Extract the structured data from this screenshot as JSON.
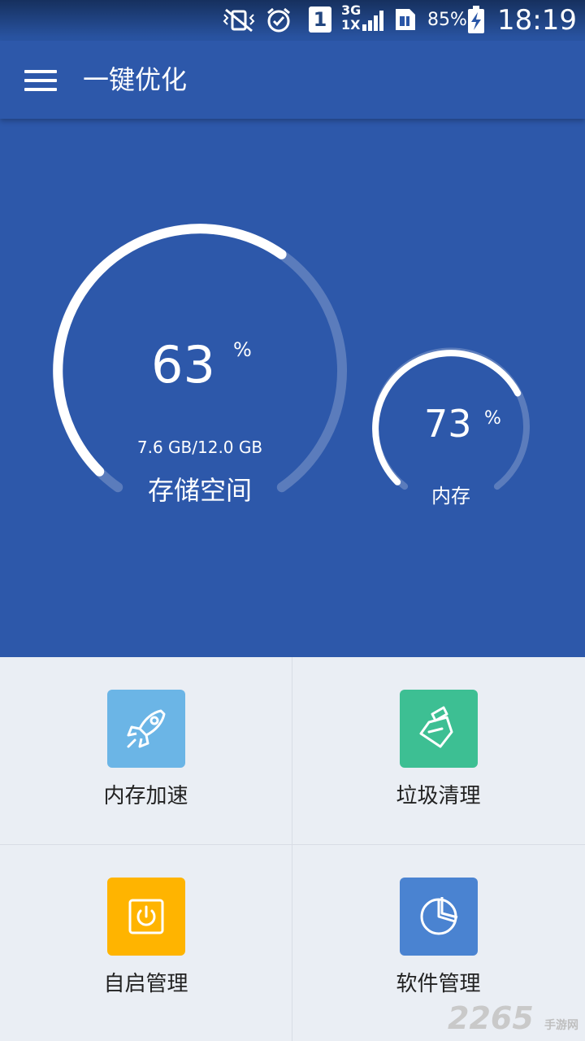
{
  "status_bar": {
    "sim_label": "1",
    "network_top": "3G",
    "network_bottom": "1X",
    "battery": "85%",
    "time": "18:19"
  },
  "app_bar": {
    "title": "一键优化",
    "menu_icon": "hamburger-menu-icon"
  },
  "storage": {
    "percent": "63",
    "percent_sign": "%",
    "detail": "7.6 GB/12.0 GB",
    "label": "存储空间",
    "level": 0.63
  },
  "memory": {
    "percent": "73",
    "percent_sign": "%",
    "label": "内存",
    "level": 0.73
  },
  "features": [
    {
      "label": "内存加速",
      "icon": "rocket-icon",
      "color": "#6bb5e6"
    },
    {
      "label": "垃圾清理",
      "icon": "broom-icon",
      "color": "#3dbf93"
    },
    {
      "label": "自启管理",
      "icon": "power-icon",
      "color": "#ffb400"
    },
    {
      "label": "软件管理",
      "icon": "pie-chart-icon",
      "color": "#4a83d1"
    }
  ],
  "colors": {
    "primary": "#2d58aa",
    "background": "#eaeef4"
  },
  "watermark": {
    "main": "2265",
    "sub": "手游网"
  }
}
